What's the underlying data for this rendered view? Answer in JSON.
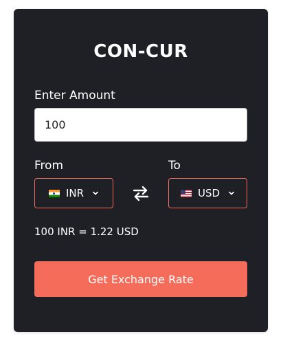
{
  "app": {
    "title": "CON-CUR"
  },
  "amount": {
    "label": "Enter Amount",
    "value": "100"
  },
  "from": {
    "label": "From",
    "currency": "INR",
    "flag_icon": "india-flag-icon"
  },
  "to": {
    "label": "To",
    "currency": "USD",
    "flag_icon": "us-flag-icon"
  },
  "swap": {
    "icon": "swap-arrows-icon"
  },
  "result": {
    "text": "100 INR = 1.22 USD"
  },
  "button": {
    "label": "Get Exchange Rate"
  },
  "colors": {
    "card_background": "#1f2026",
    "accent": "#f56d5a",
    "text": "#ffffff"
  }
}
